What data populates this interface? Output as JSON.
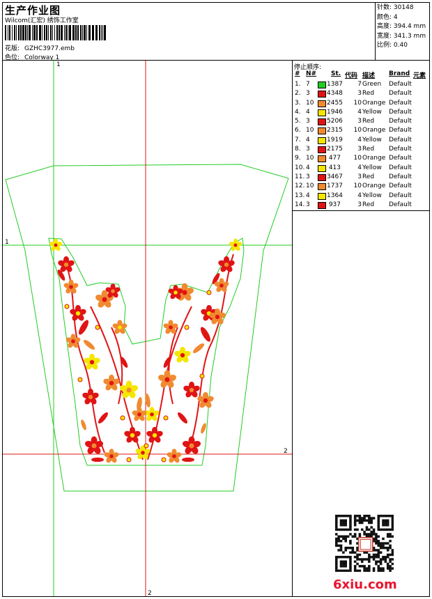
{
  "header": {
    "title": "生产作业图",
    "company": "Wilcom(汇宏) 绣饰工作室",
    "design_label": "花版:",
    "design_value": "GZHC3977.emb",
    "colorway_label": "色位:",
    "colorway_value": "Colorway 1"
  },
  "stats": [
    {
      "label": "针数:",
      "value": "30148"
    },
    {
      "label": "颜色:",
      "value": "4"
    },
    {
      "label": "高度:",
      "value": "394.4 mm"
    },
    {
      "label": "宽度:",
      "value": "341.3 mm"
    },
    {
      "label": "比例:",
      "value": "0.40"
    }
  ],
  "sequence": {
    "title": "停止顺序:",
    "headers": {
      "num": "#",
      "n": "N#",
      "st": "St.",
      "code": "代码",
      "desc": "描述",
      "brand": "Brand",
      "element": "元素"
    },
    "rows": [
      {
        "num": "1.",
        "n": "7",
        "st": "1387",
        "code": "7",
        "desc": "Green",
        "brand": "Default",
        "color": "#22cc22"
      },
      {
        "num": "2.",
        "n": "3",
        "st": "4348",
        "code": "3",
        "desc": "Red",
        "brand": "Default",
        "color": "#e01414"
      },
      {
        "num": "3.",
        "n": "10",
        "st": "2455",
        "code": "10",
        "desc": "Orange",
        "brand": "Default",
        "color": "#f08a30"
      },
      {
        "num": "4.",
        "n": "4",
        "st": "1946",
        "code": "4",
        "desc": "Yellow",
        "brand": "Default",
        "color": "#f5e600"
      },
      {
        "num": "5.",
        "n": "3",
        "st": "5206",
        "code": "3",
        "desc": "Red",
        "brand": "Default",
        "color": "#e01414"
      },
      {
        "num": "6.",
        "n": "10",
        "st": "2315",
        "code": "10",
        "desc": "Orange",
        "brand": "Default",
        "color": "#f08a30"
      },
      {
        "num": "7.",
        "n": "4",
        "st": "1919",
        "code": "4",
        "desc": "Yellow",
        "brand": "Default",
        "color": "#f5e600"
      },
      {
        "num": "8.",
        "n": "3",
        "st": "2175",
        "code": "3",
        "desc": "Red",
        "brand": "Default",
        "color": "#e01414"
      },
      {
        "num": "9.",
        "n": "10",
        "st": "477",
        "code": "10",
        "desc": "Orange",
        "brand": "Default",
        "color": "#f08a30"
      },
      {
        "num": "10.",
        "n": "4",
        "st": "413",
        "code": "4",
        "desc": "Yellow",
        "brand": "Default",
        "color": "#f5e600"
      },
      {
        "num": "11.",
        "n": "3",
        "st": "3467",
        "code": "3",
        "desc": "Red",
        "brand": "Default",
        "color": "#e01414"
      },
      {
        "num": "12.",
        "n": "10",
        "st": "1737",
        "code": "10",
        "desc": "Orange",
        "brand": "Default",
        "color": "#f08a30"
      },
      {
        "num": "13.",
        "n": "4",
        "st": "1364",
        "code": "4",
        "desc": "Yellow",
        "brand": "Default",
        "color": "#f5e600"
      },
      {
        "num": "14.",
        "n": "3",
        "st": "937",
        "code": "3",
        "desc": "Red",
        "brand": "Default",
        "color": "#e01414"
      }
    ]
  },
  "guides": {
    "v1": "1",
    "h1": "1",
    "v2": "2",
    "h2": "2"
  },
  "colors": {
    "outline": "#22cc22",
    "guide_green": "#22cc22",
    "guide_red": "#e01414",
    "red": "#e01414",
    "orange": "#f08a30",
    "yellow": "#f5e600"
  },
  "watermark": "6xiu.com"
}
